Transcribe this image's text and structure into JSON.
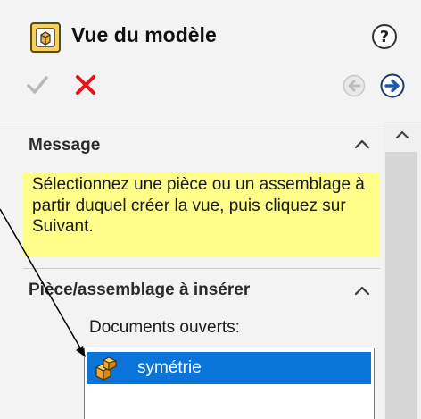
{
  "header": {
    "title": "Vue du modèle"
  },
  "sections": {
    "message": {
      "title": "Message",
      "text": "Sélectionnez une pièce ou un assemblage à partir duquel créer la vue, puis cliquez sur Suivant."
    },
    "insert": {
      "title": "Pièce/assemblage à insérer",
      "open_docs_label": "Documents ouverts:",
      "documents": [
        {
          "label": "symétrie",
          "selected": true
        }
      ]
    }
  },
  "colors": {
    "accent_selection": "#0a74d8",
    "message_background": "#fffe88",
    "cancel_red": "#e8141b",
    "next_blue": "#1e5aa8"
  },
  "icons": {
    "title": "part-model-view-icon",
    "help": "help-icon",
    "ok": "checkmark-icon",
    "cancel": "close-icon",
    "back": "back-arrow-icon",
    "next": "next-arrow-icon",
    "document": "assembly-icon"
  }
}
